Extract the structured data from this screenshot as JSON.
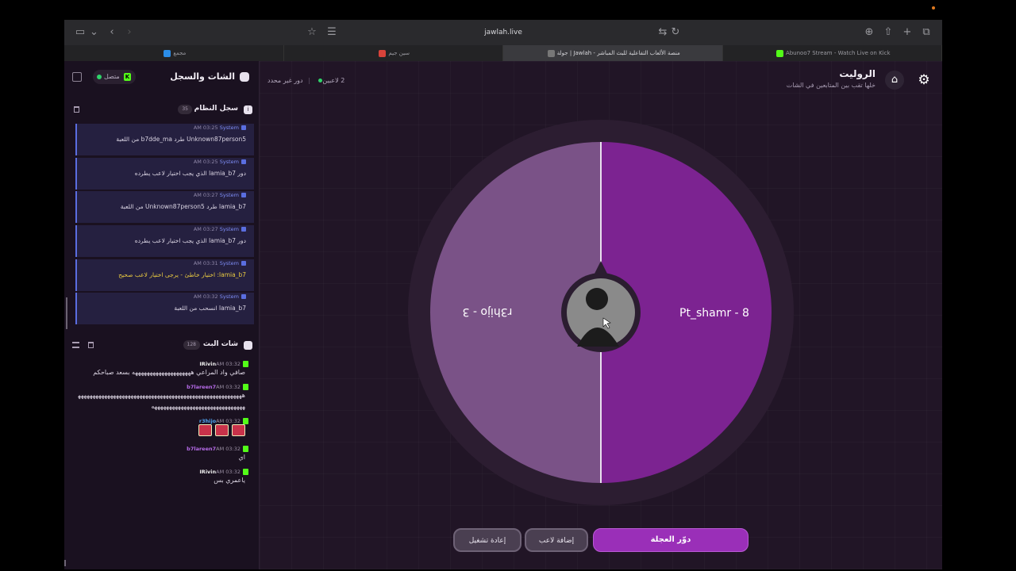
{
  "browser": {
    "url": "jawlah.live",
    "tabs": [
      {
        "label": "مجمع",
        "fav_color": "#2b8de8"
      },
      {
        "label": "سين جيم",
        "fav_color": "#d8433a"
      },
      {
        "label": "جولة | Jawlah - منصة الألعاب التفاعلية للبث المباشر",
        "fav_color": "#777"
      },
      {
        "label": "Abunoo7 Stream - Watch Live on Kick",
        "fav_color": "#53fc18"
      }
    ]
  },
  "sidebar": {
    "title": "الشات والسجل",
    "status": "متصل",
    "system_log": {
      "title": "سجل النظام",
      "count": "35",
      "messages": [
        {
          "time": "AM 03:25",
          "user": "System",
          "text": "Unknown87person5 طرد b7dde_ma من اللعبة",
          "warn": false
        },
        {
          "time": "AM 03:25",
          "user": "System",
          "text": "دور lamia_b7 الذي يجب اختيار لاعب يطرده",
          "warn": false
        },
        {
          "time": "AM 03:27",
          "user": "System",
          "text": "lamia_b7 طرد Unknown87person5 من اللعبة",
          "warn": false
        },
        {
          "time": "AM 03:27",
          "user": "System",
          "text": "دور lamia_b7 الذي يجب اختيار لاعب يطرده",
          "warn": false
        },
        {
          "time": "AM 03:31",
          "user": "System",
          "text": "lamia_b7: اختيار خاطئ - يرجى اختيار لاعب صحيح",
          "warn": true
        },
        {
          "time": "AM 03:32",
          "user": "System",
          "text": "lamia_b7 انسحب من اللعبة",
          "warn": false
        }
      ]
    },
    "live_chat": {
      "title": "شات البث",
      "count": "128",
      "messages": [
        {
          "time": "AM 03:32",
          "user": "IRivin",
          "color": "#eeeeee",
          "text": "صافي واد المراعي ههههههههههههههههههههه بسعد صباحكم",
          "emotes": 0
        },
        {
          "time": "AM 03:32",
          "user": "b7lareen7",
          "color": "#b66be8",
          "text": "ههههههههههههههههههههههههههههههههههههههههههههههههههههههههههههههههههههههههههههههههههههههههه",
          "emotes": 0
        },
        {
          "time": "AM 03:32",
          "user": "r3hijo",
          "color": "#4fa3f0",
          "text": "",
          "emotes": 3
        },
        {
          "time": "AM 03:32",
          "user": "b7lareen7",
          "color": "#b66be8",
          "text": "اي",
          "emotes": 0
        },
        {
          "time": "AM 03:32",
          "user": "IRivin",
          "color": "#eeeeee",
          "text": "ياعمري بس",
          "emotes": 0
        }
      ]
    }
  },
  "main": {
    "title": "الروليت",
    "subtitle": "خلها تقب بين المتابعين في الشات",
    "players_count": "2 لاعبين",
    "turn_status": "دور غير محدد",
    "wheel": {
      "segments": [
        {
          "label": "Pt_shamr - 8",
          "color": "#7c2391"
        },
        {
          "label": "r3hijo - 3",
          "color": "#7a5287"
        }
      ]
    },
    "buttons": {
      "spin": "دوّر العجلة",
      "add_player": "إضافة لاعب",
      "restart": "إعادة تشغيل"
    }
  }
}
